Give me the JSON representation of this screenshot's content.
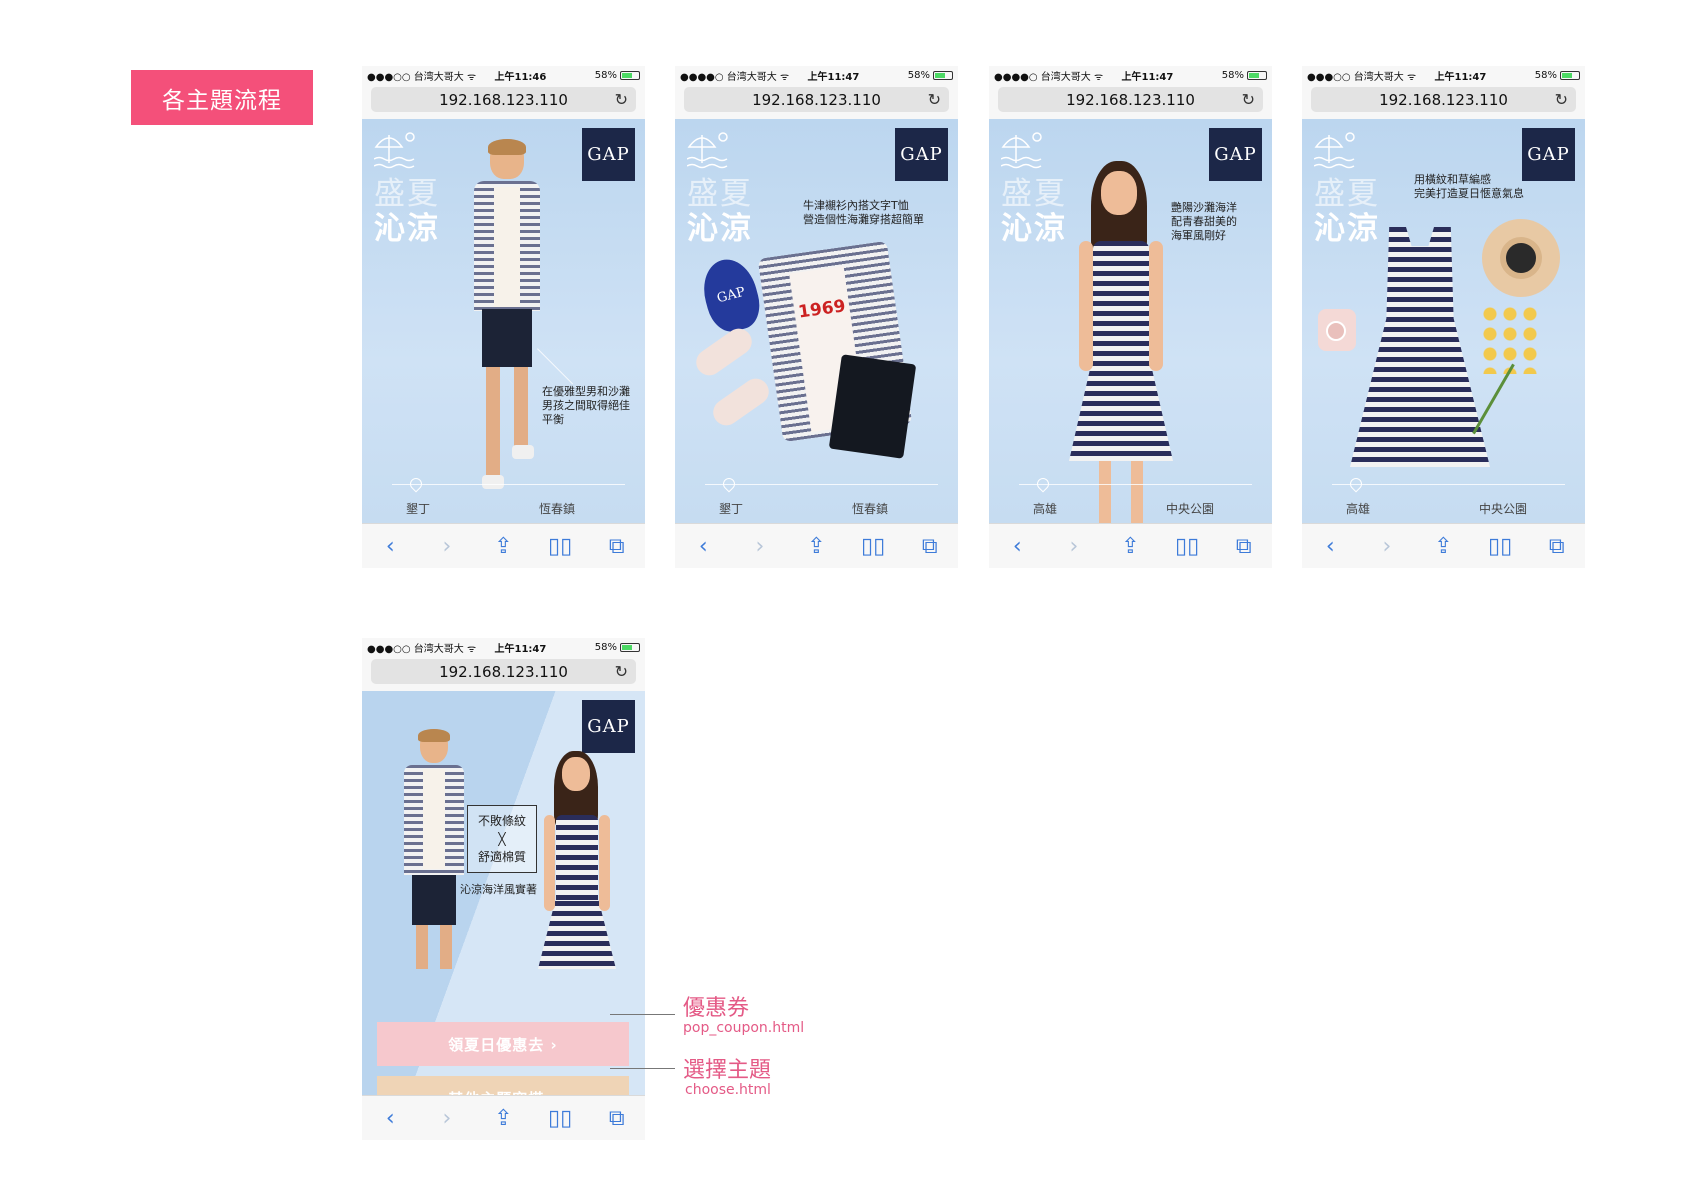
{
  "section_label": "各主題流程",
  "statusbar": {
    "carrier": "●●●○○ 台湾大哥大 ᯤ",
    "carrier_full": "●●●●○ 台湾大哥大 ᯤ",
    "time_a": "上午11:46",
    "time_b": "上午11:47",
    "battery": "58%"
  },
  "urlbar": {
    "url": "192.168.123.110",
    "reload_icon": "↻"
  },
  "toolbar": {
    "back": "‹",
    "forward": "›",
    "share": "⇪",
    "bookmarks": "▯▯",
    "tabs": "⧉"
  },
  "brand": {
    "logo": "GAP"
  },
  "theme_title": {
    "line1": "盛夏",
    "line2": "沁涼"
  },
  "screens": [
    {
      "copy": "在優雅型男和沙灘\n男孩之間取得絕佳\n平衡",
      "loc_left": "墾丁",
      "loc_right": "恆春鎮"
    },
    {
      "copy": "牛津襯衫內搭文字T恤\n營造個性海灘穿搭超簡單",
      "loc_left": "墾丁",
      "loc_right": "恆春鎮",
      "cap_text": "GAP",
      "tee_text": "1969"
    },
    {
      "copy": "艷陽沙灘海洋\n配青春甜美的\n海軍風剛好",
      "loc_left": "高雄",
      "loc_right": "中央公園"
    },
    {
      "copy": "用橫紋和草編感\n完美打造夏日愜意氣息",
      "loc_left": "高雄",
      "loc_right": "中央公園"
    }
  ],
  "promo": {
    "line1": "不敗條紋",
    "cross": "╳",
    "line2": "舒適棉質",
    "caption": "沁涼海洋風實著",
    "coupon_button": "領夏日優惠去 ›",
    "other_button": "其他主題穿搭 ›"
  },
  "annotations": [
    {
      "title": "優惠券",
      "file": "pop_coupon.html"
    },
    {
      "title": "選擇主題",
      "file": "choose.html"
    }
  ],
  "colors": {
    "accent": "#f4507a",
    "annotation": "#e45a86",
    "navy": "#1c2748",
    "ios_blue": "#3d7bd9"
  }
}
